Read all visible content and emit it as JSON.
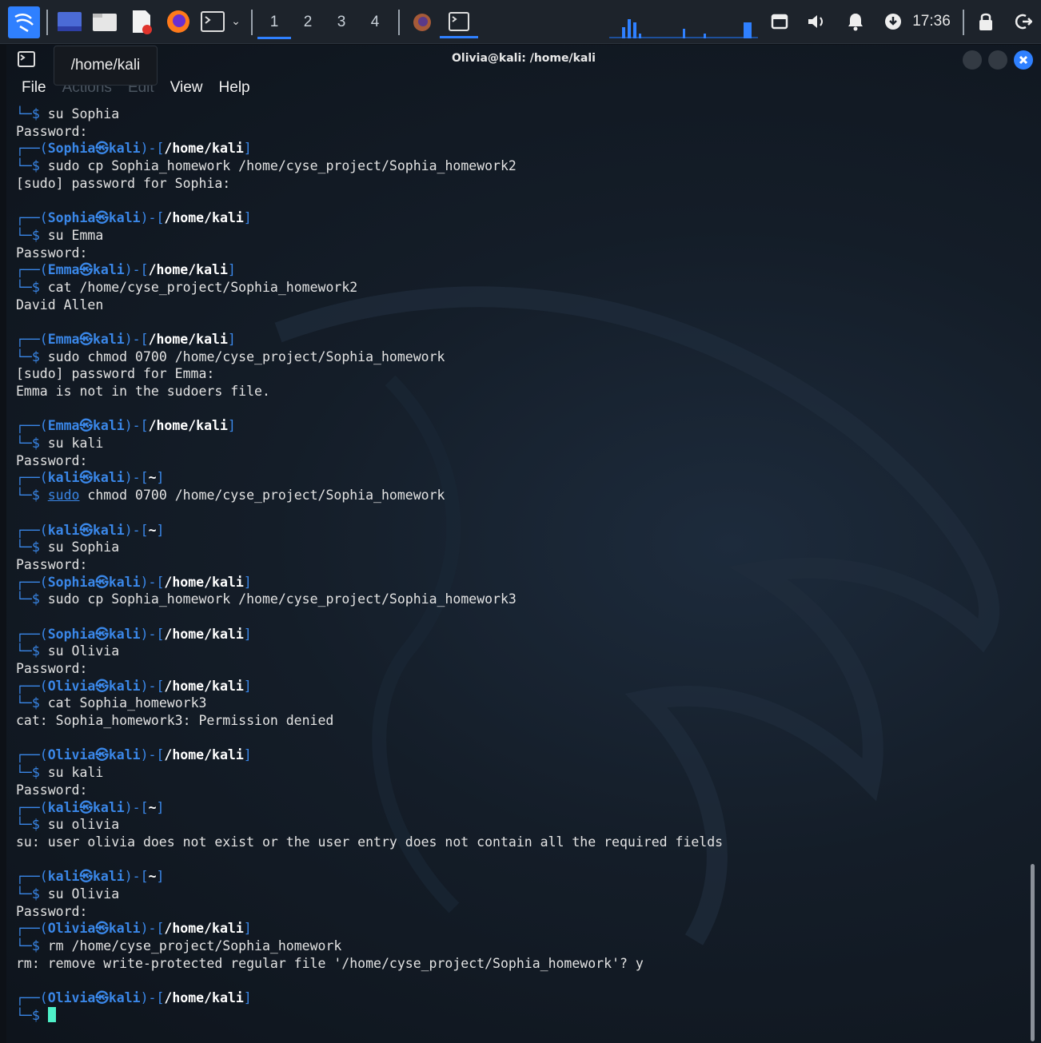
{
  "panel": {
    "workspaces": [
      "1",
      "2",
      "3",
      "4"
    ],
    "clock": "17:36",
    "colors": {
      "accent": "#2f80ff",
      "background": "#1d232b"
    }
  },
  "window": {
    "title": "Olivia@kali: /home/kali",
    "tooltip": "/home/kali",
    "menu": [
      "File",
      "Actions",
      "Edit",
      "View",
      "Help"
    ]
  },
  "terminal": {
    "lines": [
      {
        "kind": "cmd",
        "cmd": "su",
        "args": " Sophia"
      },
      {
        "kind": "out",
        "text": "Password:"
      },
      {
        "kind": "prompt",
        "user": "Sophia",
        "host": "kali",
        "path": "/home/kali"
      },
      {
        "kind": "cmd",
        "cmd": "sudo",
        "args": " cp Sophia_homework /home/cyse_project/Sophia_homework2"
      },
      {
        "kind": "out",
        "text": "[sudo] password for Sophia:"
      },
      {
        "kind": "blank"
      },
      {
        "kind": "prompt",
        "user": "Sophia",
        "host": "kali",
        "path": "/home/kali"
      },
      {
        "kind": "cmd",
        "cmd": "su",
        "args": " Emma"
      },
      {
        "kind": "out",
        "text": "Password:"
      },
      {
        "kind": "prompt",
        "user": "Emma",
        "host": "kali",
        "path": "/home/kali"
      },
      {
        "kind": "cmd",
        "cmd": "cat",
        "args": " /home/cyse_project/Sophia_homework2"
      },
      {
        "kind": "out",
        "text": "David Allen"
      },
      {
        "kind": "blank"
      },
      {
        "kind": "prompt",
        "user": "Emma",
        "host": "kali",
        "path": "/home/kali"
      },
      {
        "kind": "cmd",
        "cmd": "sudo",
        "args": " chmod 0700 /home/cyse_project/Sophia_homework"
      },
      {
        "kind": "out",
        "text": "[sudo] password for Emma:"
      },
      {
        "kind": "out",
        "text": "Emma is not in the sudoers file."
      },
      {
        "kind": "blank"
      },
      {
        "kind": "prompt",
        "user": "Emma",
        "host": "kali",
        "path": "/home/kali"
      },
      {
        "kind": "cmd",
        "cmd": "su",
        "args": " kali"
      },
      {
        "kind": "out",
        "text": "Password:"
      },
      {
        "kind": "prompt",
        "user": "kali",
        "host": "kali",
        "path": "~"
      },
      {
        "kind": "cmd",
        "cmd": "sudo",
        "args": " chmod 0700 /home/cyse_project/Sophia_homework",
        "underline": true
      },
      {
        "kind": "blank"
      },
      {
        "kind": "prompt",
        "user": "kali",
        "host": "kali",
        "path": "~"
      },
      {
        "kind": "cmd",
        "cmd": "su",
        "args": " Sophia"
      },
      {
        "kind": "out",
        "text": "Password:"
      },
      {
        "kind": "prompt",
        "user": "Sophia",
        "host": "kali",
        "path": "/home/kali"
      },
      {
        "kind": "cmd",
        "cmd": "sudo",
        "args": " cp Sophia_homework /home/cyse_project/Sophia_homework3"
      },
      {
        "kind": "blank"
      },
      {
        "kind": "prompt",
        "user": "Sophia",
        "host": "kali",
        "path": "/home/kali"
      },
      {
        "kind": "cmd",
        "cmd": "su",
        "args": " Olivia"
      },
      {
        "kind": "out",
        "text": "Password:"
      },
      {
        "kind": "prompt",
        "user": "Olivia",
        "host": "kali",
        "path": "/home/kali"
      },
      {
        "kind": "cmd",
        "cmd": "cat",
        "args": " Sophia_homework3"
      },
      {
        "kind": "out",
        "text": "cat: Sophia_homework3: Permission denied"
      },
      {
        "kind": "blank"
      },
      {
        "kind": "prompt",
        "user": "Olivia",
        "host": "kali",
        "path": "/home/kali"
      },
      {
        "kind": "cmd",
        "cmd": "su",
        "args": " kali"
      },
      {
        "kind": "out",
        "text": "Password:"
      },
      {
        "kind": "prompt",
        "user": "kali",
        "host": "kali",
        "path": "~"
      },
      {
        "kind": "cmd",
        "cmd": "su",
        "args": " olivia"
      },
      {
        "kind": "out",
        "text": "su: user olivia does not exist or the user entry does not contain all the required fields"
      },
      {
        "kind": "blank"
      },
      {
        "kind": "prompt",
        "user": "kali",
        "host": "kali",
        "path": "~"
      },
      {
        "kind": "cmd",
        "cmd": "su",
        "args": " Olivia"
      },
      {
        "kind": "out",
        "text": "Password:"
      },
      {
        "kind": "prompt",
        "user": "Olivia",
        "host": "kali",
        "path": "/home/kali"
      },
      {
        "kind": "cmd",
        "cmd": "rm",
        "args": " /home/cyse_project/Sophia_homework"
      },
      {
        "kind": "out",
        "text": "rm: remove write-protected regular file '/home/cyse_project/Sophia_homework'? y"
      },
      {
        "kind": "blank"
      },
      {
        "kind": "prompt",
        "user": "Olivia",
        "host": "kali",
        "path": "/home/kali"
      },
      {
        "kind": "cursor"
      }
    ]
  }
}
